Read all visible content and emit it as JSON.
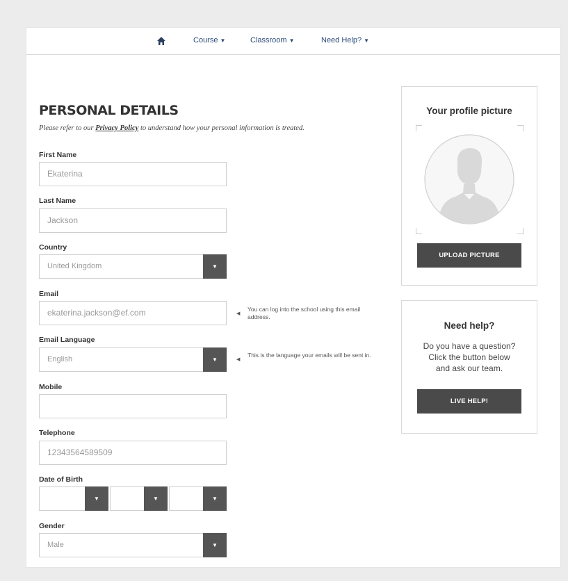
{
  "nav": {
    "items": [
      {
        "label": "Course"
      },
      {
        "label": "Classroom"
      },
      {
        "label": "Need Help?"
      }
    ]
  },
  "page": {
    "heading": "PERSONAL DETAILS",
    "subtext_before": "Please refer to our ",
    "privacy_link": "Privacy Policy",
    "subtext_after": " to understand how your personal information is treated."
  },
  "form": {
    "first_name_label": "First Name",
    "first_name_value": "Ekaterina",
    "last_name_label": "Last Name",
    "last_name_value": "Jackson",
    "country_label": "Country",
    "country_value": "United Kingdom",
    "email_label": "Email",
    "email_value": "ekaterina.jackson@ef.com",
    "email_hint": "You can log into the school using this email address.",
    "email_language_label": "Email Language",
    "email_language_value": "English",
    "email_language_hint": "This is the language your emails will be sent in.",
    "mobile_label": "Mobile",
    "mobile_value": "",
    "telephone_label": "Telephone",
    "telephone_value": "12343564589509",
    "dob_label": "Date of Birth",
    "gender_label": "Gender",
    "gender_value": "Male"
  },
  "profile_panel": {
    "title": "Your profile picture",
    "button": "UPLOAD PICTURE"
  },
  "help_panel": {
    "title": "Need help?",
    "lines": [
      "Do you have a question?",
      "Click the button below",
      "and ask our team."
    ],
    "button": "LIVE HELP!"
  },
  "colors": {
    "nav_link": "#2a4a7a",
    "button_bg": "#4a4a4a",
    "dropdown_arrow_bg": "#555555",
    "page_bg": "#ececec"
  },
  "icons": {
    "home": "home-icon",
    "caret": "caret-down-icon",
    "avatar": "user-silhouette-icon"
  }
}
